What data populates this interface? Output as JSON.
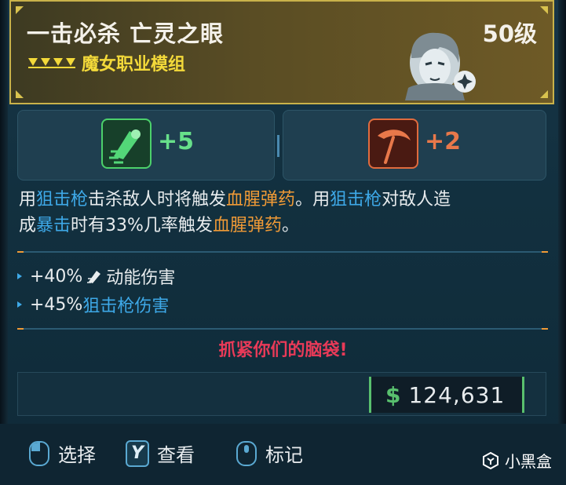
{
  "item": {
    "name": "一击必杀 亡灵之眼",
    "level": "50级",
    "type": "魔女职业模组"
  },
  "stats": [
    {
      "icon": "kinetic-skill-icon",
      "value": "+5",
      "color": "#67e08a"
    },
    {
      "icon": "reaper-scythe-icon",
      "value": "+2",
      "color": "#e8784a"
    }
  ],
  "description": {
    "line1": [
      {
        "text": "用",
        "style": "normal"
      },
      {
        "text": "狙击枪",
        "style": "blue"
      },
      {
        "text": "击杀敌人时将触发",
        "style": "normal"
      },
      {
        "text": "血腥弹药",
        "style": "orange"
      },
      {
        "text": "。用",
        "style": "normal"
      },
      {
        "text": "狙击枪",
        "style": "blue"
      },
      {
        "text": "对敌人造",
        "style": "normal"
      }
    ],
    "line2": [
      {
        "text": "成",
        "style": "normal"
      },
      {
        "text": "暴击",
        "style": "blue"
      },
      {
        "text": "时有33%几率触发",
        "style": "normal"
      },
      {
        "text": "血腥弹药",
        "style": "orange"
      },
      {
        "text": "。",
        "style": "normal"
      }
    ]
  },
  "bonuses": [
    {
      "prefix": "+40%",
      "suffix": "动能伤害",
      "has_icon": true
    },
    {
      "prefix": "+45%",
      "suffix": "狙击枪伤害",
      "has_icon": false
    }
  ],
  "flavor_text": "抓紧你们的脑袋!",
  "price": {
    "currency": "$",
    "value": "124,631"
  },
  "actions": [
    {
      "label": "选择",
      "key": "mouse-left"
    },
    {
      "label": "查看",
      "key": "Y"
    },
    {
      "label": "标记",
      "key": "mouse-middle"
    }
  ],
  "watermark": "小黑盒",
  "colors": {
    "header_gold": "#c9b24a",
    "type_yellow": "#f3d93a",
    "highlight_blue": "#3ea9e8",
    "highlight_orange": "#f09a36",
    "flavor_red": "#e83a58",
    "money_green": "#59c06e"
  }
}
